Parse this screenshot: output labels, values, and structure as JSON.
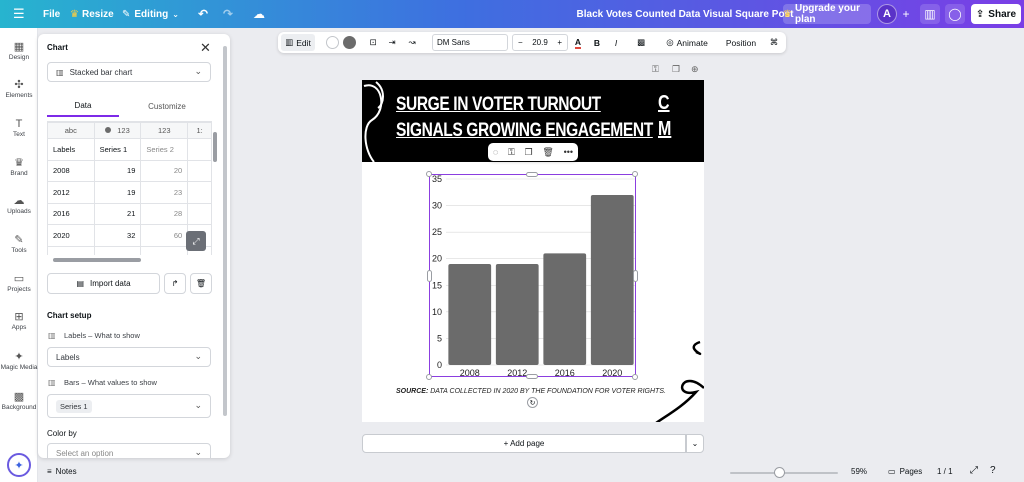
{
  "topbar": {
    "file": "File",
    "resize": "Resize",
    "editing": "Editing",
    "doc_title": "Black Votes Counted Data Visual Square Post",
    "upgrade": "Upgrade your plan",
    "avatar_initial": "A",
    "share": "Share"
  },
  "rail": [
    {
      "label": "Design",
      "icon": "design-icon",
      "glyph": "▦"
    },
    {
      "label": "Elements",
      "icon": "elements-icon",
      "glyph": "✣"
    },
    {
      "label": "Text",
      "icon": "text-icon",
      "glyph": "T"
    },
    {
      "label": "Brand",
      "icon": "brand-icon",
      "glyph": "♛"
    },
    {
      "label": "Uploads",
      "icon": "uploads-icon",
      "glyph": "☁"
    },
    {
      "label": "Tools",
      "icon": "tools-icon",
      "glyph": "✎"
    },
    {
      "label": "Projects",
      "icon": "projects-icon",
      "glyph": "▭"
    },
    {
      "label": "Apps",
      "icon": "apps-icon",
      "glyph": "⊞"
    },
    {
      "label": "Magic Media",
      "icon": "magic-media-icon",
      "glyph": "✦"
    },
    {
      "label": "Background",
      "icon": "background-icon",
      "glyph": "▩"
    }
  ],
  "panel": {
    "title": "Chart",
    "chart_type": "Stacked bar chart",
    "tabs": [
      "Data",
      "Customize"
    ],
    "table": {
      "type_row": [
        "abc",
        "123",
        "123",
        "1:"
      ],
      "header": [
        "Labels",
        "Series 1",
        "Series 2",
        ""
      ],
      "rows": [
        [
          "2008",
          "19",
          "20",
          ""
        ],
        [
          "2012",
          "19",
          "23",
          ""
        ],
        [
          "2016",
          "21",
          "28",
          ""
        ],
        [
          "2020",
          "32",
          "60",
          ""
        ]
      ]
    },
    "import_data": "Import data",
    "chart_setup": "Chart setup",
    "labels_title": "Labels – What to show",
    "labels_value": "Labels",
    "bars_title": "Bars – What values to show",
    "bars_value": "Series 1",
    "color_by": "Color by",
    "color_placeholder": "Select an option"
  },
  "toolbar": {
    "edit": "Edit",
    "font": "DM Sans",
    "size": "20.9",
    "animate": "Animate",
    "position": "Position",
    "color_white": "#ffffff",
    "color_gray": "#6b6b6b"
  },
  "design": {
    "headline_1": "SURGE IN VOTER TURNOUT",
    "headline_2": "SIGNALS GROWING ENGAGEMENT",
    "logo_1": "C",
    "logo_2": "M",
    "source_label": "SOURCE:",
    "source_text": " DATA COLLECTED IN 2020 BY THE FOUNDATION FOR VOTER RIGHTS."
  },
  "chart_data": {
    "type": "bar",
    "categories": [
      "2008",
      "2012",
      "2016",
      "2020"
    ],
    "series": [
      {
        "name": "Series 1",
        "values": [
          19,
          19,
          21,
          32
        ]
      }
    ],
    "ylim": [
      0,
      35
    ],
    "yticks": [
      0,
      5,
      10,
      15,
      20,
      25,
      30,
      35
    ],
    "bar_color": "#6b6b6b",
    "grid": true,
    "legend": "none"
  },
  "add_page": "+ Add page",
  "bottombar": {
    "notes": "Notes",
    "zoom": "59%",
    "pages": "Pages",
    "page_count": "1 / 1"
  }
}
